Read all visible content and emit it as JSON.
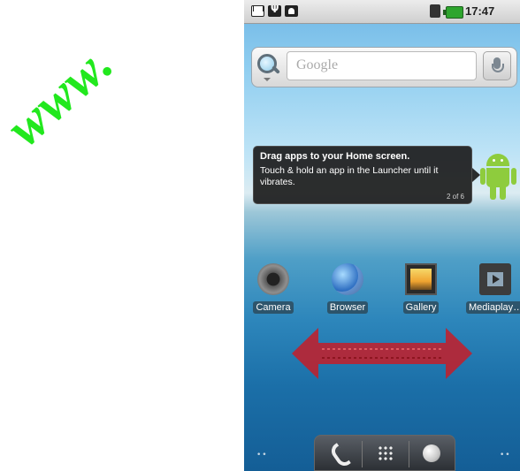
{
  "watermark": {
    "text": "www."
  },
  "statusbar": {
    "time": "17:47",
    "icons": [
      "gmail-icon",
      "usb-icon",
      "debug-icon",
      "wifi-icon",
      "battery-icon"
    ]
  },
  "search": {
    "placeholder": "Google"
  },
  "tip": {
    "title": "Drag apps to your Home screen.",
    "body": "Touch & hold an app in the Launcher until it vibrates.",
    "count": "2 of 6"
  },
  "apps": [
    {
      "label": "Camera",
      "icon": "camera-icon"
    },
    {
      "label": "Browser",
      "icon": "globe-icon"
    },
    {
      "label": "Gallery",
      "icon": "gallery-icon"
    },
    {
      "label": "Mediaplay…",
      "icon": "film-icon"
    }
  ],
  "colors": {
    "watermark": "#22e81e",
    "arrow": "#c0202c",
    "android": "#8ecc3d"
  },
  "page_indicator": {
    "left": "••",
    "right": "••"
  }
}
